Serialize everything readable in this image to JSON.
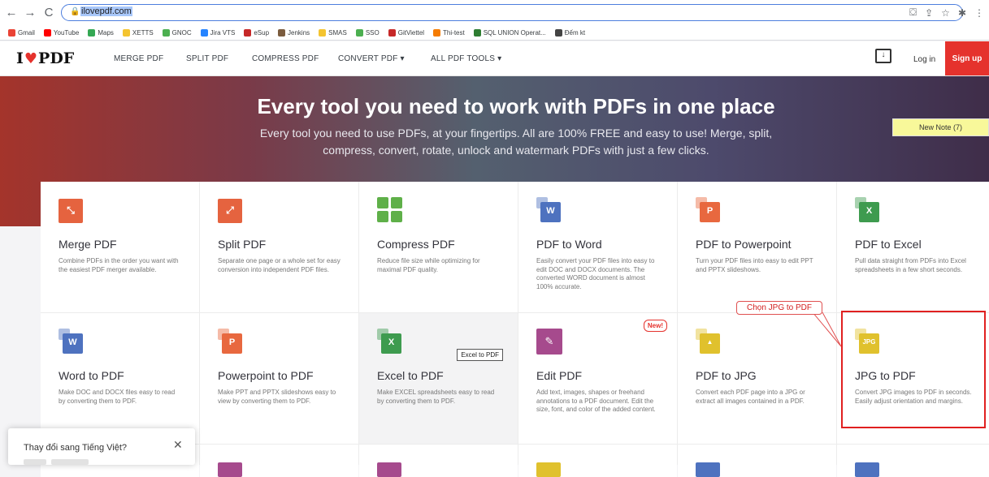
{
  "browser": {
    "url": "ilovepdf.com",
    "bookmarks": [
      {
        "label": "Gmail",
        "color": "#ea4335"
      },
      {
        "label": "YouTube",
        "color": "#ff0000"
      },
      {
        "label": "Maps",
        "color": "#34a853"
      },
      {
        "label": "XETTS",
        "color": "#f4c430"
      },
      {
        "label": "GNOC",
        "color": "#4caf50"
      },
      {
        "label": "Jira VTS",
        "color": "#2684ff"
      },
      {
        "label": "eSup",
        "color": "#c62828"
      },
      {
        "label": "Jenkins",
        "color": "#7b5c3e"
      },
      {
        "label": "SMAS",
        "color": "#f4c430"
      },
      {
        "label": "SSO",
        "color": "#4caf50"
      },
      {
        "label": "GitViettel",
        "color": "#c62828"
      },
      {
        "label": "Thi-test",
        "color": "#f57c00"
      },
      {
        "label": "SQL UNION Operat...",
        "color": "#2e7d32"
      },
      {
        "label": "Đếm kt",
        "color": "#444444"
      }
    ]
  },
  "header": {
    "nav": [
      "MERGE PDF",
      "SPLIT PDF",
      "COMPRESS PDF",
      "CONVERT PDF ▾",
      "ALL PDF TOOLS ▾"
    ],
    "login": "Log in",
    "signup": "Sign up"
  },
  "hero": {
    "title": "Every tool you need to work with PDFs in one place",
    "subtitle": "Every tool you need to use PDFs, at your fingertips. All are 100% FREE and easy to use! Merge, split, compress, convert, rotate, unlock and watermark PDFs with just a few clicks.",
    "note": "New Note (7)"
  },
  "tools": [
    {
      "title": "Merge PDF",
      "desc": "Combine PDFs in the order you want with the easiest PDF merger available.",
      "color": "#e5633f",
      "icon": "merge-icon"
    },
    {
      "title": "Split PDF",
      "desc": "Separate one page or a whole set for easy conversion into independent PDF files.",
      "color": "#e5633f",
      "icon": "split-icon"
    },
    {
      "title": "Compress PDF",
      "desc": "Reduce file size while optimizing for maximal PDF quality.",
      "color": "#5fb049",
      "icon": "compress-icon"
    },
    {
      "title": "PDF to Word",
      "desc": "Easily convert your PDF files into easy to edit DOC and DOCX documents. The converted WORD document is almost 100% accurate.",
      "color": "#4e72bf",
      "letter": "W",
      "icon": "word-icon"
    },
    {
      "title": "PDF to Powerpoint",
      "desc": "Turn your PDF files into easy to edit PPT and PPTX slideshows.",
      "color": "#e8683f",
      "letter": "P",
      "icon": "powerpoint-icon"
    },
    {
      "title": "PDF to Excel",
      "desc": "Pull data straight from PDFs into Excel spreadsheets in a few short seconds.",
      "color": "#3e9b4f",
      "letter": "X",
      "icon": "excel-icon"
    },
    {
      "title": "Word to PDF",
      "desc": "Make DOC and DOCX files easy to read by converting them to PDF.",
      "color": "#4e72bf",
      "letter": "W",
      "icon": "word-icon"
    },
    {
      "title": "Powerpoint to PDF",
      "desc": "Make PPT and PPTX slideshows easy to view by converting them to PDF.",
      "color": "#e8683f",
      "letter": "P",
      "icon": "powerpoint-icon"
    },
    {
      "title": "Excel to PDF",
      "desc": "Make EXCEL spreadsheets easy to read by converting them to PDF.",
      "color": "#3e9b4f",
      "letter": "X",
      "icon": "excel-icon",
      "tooltip": "Excel to PDF"
    },
    {
      "title": "Edit PDF",
      "desc": "Add text, images, shapes or freehand annotations to a PDF document. Edit the size, font, and color of the added content.",
      "color": "#a64a8d",
      "icon": "edit-icon",
      "badge": "New!"
    },
    {
      "title": "PDF to JPG",
      "desc": "Convert each PDF page into a JPG or extract all images contained in a PDF.",
      "color": "#e0c12d",
      "icon": "jpg-icon"
    },
    {
      "title": "JPG to PDF",
      "desc": "Convert JPG images to PDF in seconds. Easily adjust orientation and margins.",
      "color": "#e0c12d",
      "icon": "jpg-icon",
      "letter": "JPG"
    }
  ],
  "annotation": "Chọn JPG to PDF",
  "lang_popup": {
    "text": "Thay đổi sang Tiếng Việt?"
  }
}
